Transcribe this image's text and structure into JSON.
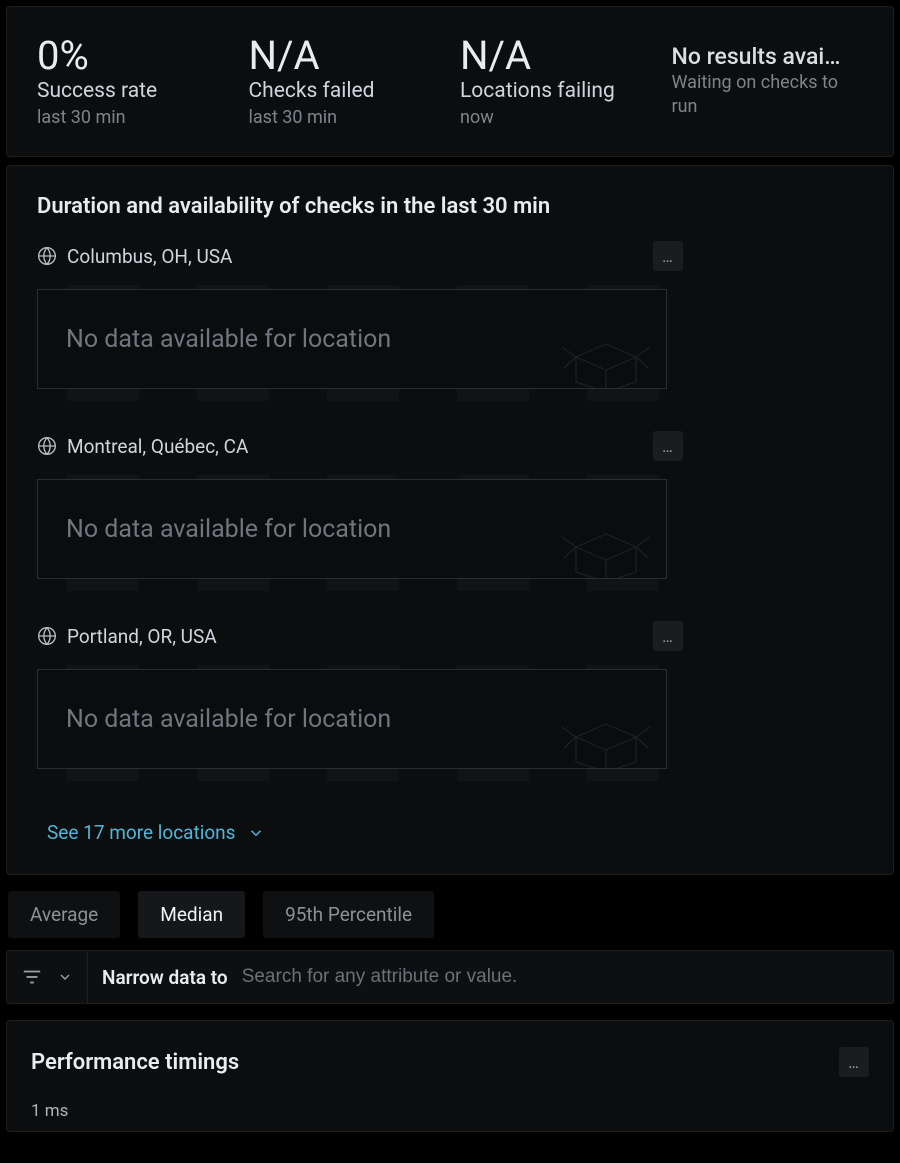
{
  "kpis": [
    {
      "value": "0%",
      "label": "Success rate",
      "sub": "last 30 min"
    },
    {
      "value": "N/A",
      "label": "Checks failed",
      "sub": "last 30 min"
    },
    {
      "value": "N/A",
      "label": "Locations failing",
      "sub": "now"
    }
  ],
  "no_results": {
    "title": "No results avai…",
    "sub": "Waiting on checks to run"
  },
  "duration": {
    "title": "Duration and availability of checks in the last 30 min",
    "no_data_text": "No data available for location",
    "locations": [
      {
        "name": "Columbus, OH, USA"
      },
      {
        "name": "Montreal, Québec, CA"
      },
      {
        "name": "Portland, OR, USA"
      }
    ],
    "see_more": "See 17 more locations"
  },
  "tabs": [
    {
      "label": "Average",
      "active": false
    },
    {
      "label": "Median",
      "active": true
    },
    {
      "label": "95th Percentile",
      "active": false
    }
  ],
  "filter": {
    "label": "Narrow data to",
    "placeholder": "Search for any attribute or value."
  },
  "perf": {
    "title": "Performance timings",
    "scale": "1 ms"
  },
  "icons": {
    "more": "…"
  }
}
